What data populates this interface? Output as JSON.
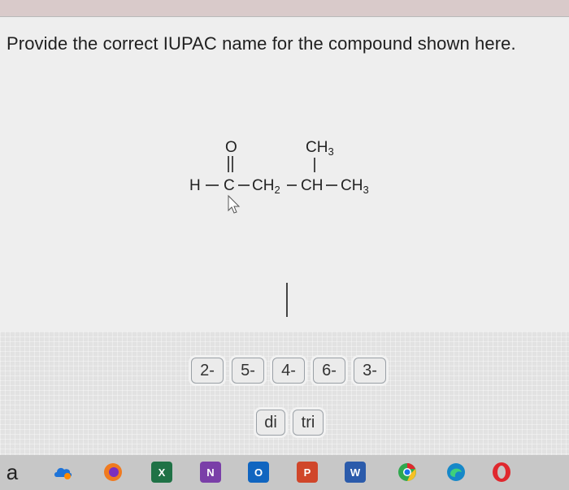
{
  "question": {
    "text": "Provide the correct IUPAC name for the compound shown here."
  },
  "structure": {
    "oxygen": "O",
    "methyl_top": "CH3",
    "hydrogen": "H",
    "carbonyl_carbon": "C",
    "ch2": "CH2",
    "ch": "CH",
    "ch3_end": "CH3"
  },
  "answer_tiles": {
    "row1": [
      "2-",
      "5-",
      "4-",
      "6-",
      "3-"
    ],
    "row2": [
      "di",
      "tri"
    ]
  },
  "taskbar": {
    "letter": "a",
    "icons": [
      {
        "name": "cloud-drive-icon",
        "label": "",
        "color": "#1e73d8"
      },
      {
        "name": "firefox-icon",
        "label": "",
        "color": "#f07a1f"
      },
      {
        "name": "excel-icon",
        "label": "X",
        "color": "#1f7246"
      },
      {
        "name": "onenote-icon",
        "label": "N",
        "color": "#7a3fa8"
      },
      {
        "name": "outlook-icon",
        "label": "O",
        "color": "#1065c0"
      },
      {
        "name": "powerpoint-icon",
        "label": "P",
        "color": "#d0462a"
      },
      {
        "name": "word-icon",
        "label": "W",
        "color": "#2b5bab"
      },
      {
        "name": "chrome-icon",
        "label": "",
        "color": "#2fa84f"
      },
      {
        "name": "edge-icon",
        "label": "",
        "color": "#1688c8"
      },
      {
        "name": "opera-icon",
        "label": "",
        "color": "#e0282e"
      }
    ]
  }
}
